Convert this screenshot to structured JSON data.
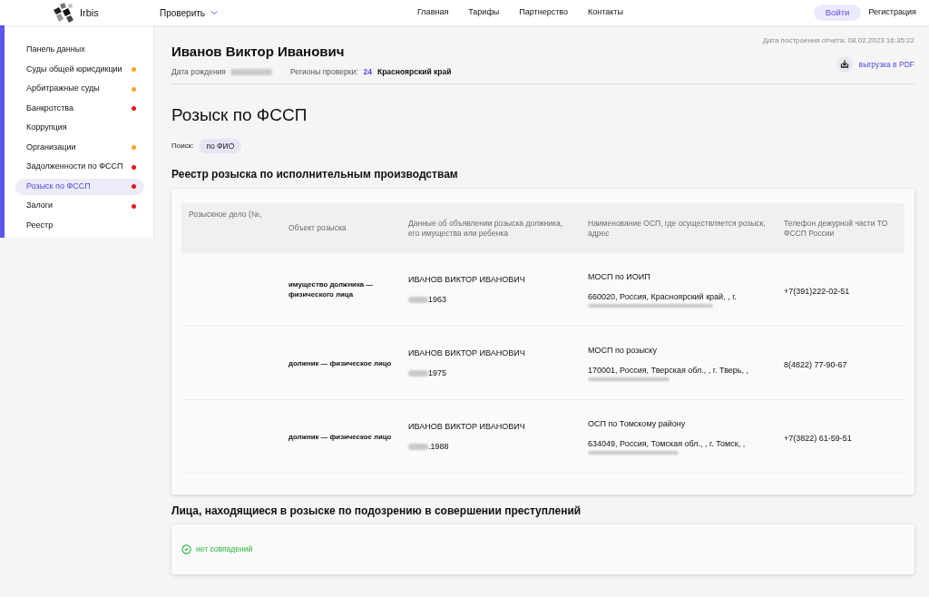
{
  "nav": {
    "logo": "Irbis",
    "menu": "Проверить",
    "links": [
      "Главная",
      "Тарифы",
      "Партнерство",
      "Контакты"
    ],
    "login": "Войти",
    "register": "Регистрация"
  },
  "sidebar": {
    "items": [
      {
        "label": "Панель данных",
        "selected": false
      },
      {
        "label": "Суды общей юрисдикции",
        "selected": false,
        "color": "#f5a623"
      },
      {
        "label": "Арбитражные суды",
        "selected": false,
        "color": "#f5a623"
      },
      {
        "label": "Банкротства",
        "selected": false,
        "color": "#e8141c"
      },
      {
        "label": "Коррупция",
        "selected": false
      },
      {
        "label": "Организации",
        "selected": false,
        "color": "#f5a623"
      },
      {
        "label": "Задолженности по ФССП",
        "selected": false,
        "color": "#e8141c"
      },
      {
        "label": "Розыск по ФССП",
        "selected": true,
        "color": "#e8141c"
      },
      {
        "label": "Залоги",
        "selected": false,
        "color": "#e8141c"
      },
      {
        "label": "Реестр",
        "selected": false
      }
    ]
  },
  "person": {
    "name": "Иванов Виктор Иванович",
    "birth_label": "Дата рождения",
    "regions_label": "Регионы проверки:",
    "region_code": "24",
    "region_name": "Красноярский край"
  },
  "report": {
    "date": "Дата построения отчета: 08.02.2023 16:35:22",
    "export": "выгрузка в PDF"
  },
  "page_title": "Розыск по ФССП",
  "search": {
    "label": "Поиск:",
    "value": "по ФИО"
  },
  "sections": [
    {
      "kind": "table",
      "title": "Реестр розыска по исполнительным производствам",
      "table": {
        "columns": [
          "Розыскное дело (№,",
          "Объект розыска",
          "Данные об объявлении розыска должника, его имущества или ребенка",
          "Наименование ОСП, где осуществляется розыск, адрес",
          "Телефон дежурной части ТО ФССП России"
        ],
        "rows": [
          {
            "object": "имущество должника — физического лица",
            "debtor_name": "ИВАНОВ ВИКТОР ИВАНОВИЧ",
            "birth_date": "1963",
            "osp_name": "МОСП по ИОИП",
            "osp_address": "660020, Россия, Красноярский край, , г.",
            "phone": "+7(391)222-02-51"
          },
          {
            "object": "должник — физическое лицо",
            "debtor_name": "ИВАНОВ ВИКТОР ИВАНОВИЧ",
            "birth_date": "1975",
            "osp_name": "МОСП по розыску",
            "osp_address": "170001, Россия, Тверская обл., , г. Тверь, ,",
            "phone": "8(4822) 77-90-67"
          },
          {
            "object": "должник — физическое лицо",
            "debtor_name": "ИВАНОВ ВИКТОР ИВАНОВИЧ",
            "birth_date": ".1988",
            "osp_name": "ОСП по Томскому району",
            "osp_address": "634049, Россия, Томская обл., , г. Томск, ,",
            "phone": "+7(3822) 61-59-51"
          }
        ]
      }
    },
    {
      "kind": "empty",
      "title": "Лица, находящиеся в розыске по подозрению в совершении преступлений",
      "message": "нет совпадений"
    }
  ]
}
